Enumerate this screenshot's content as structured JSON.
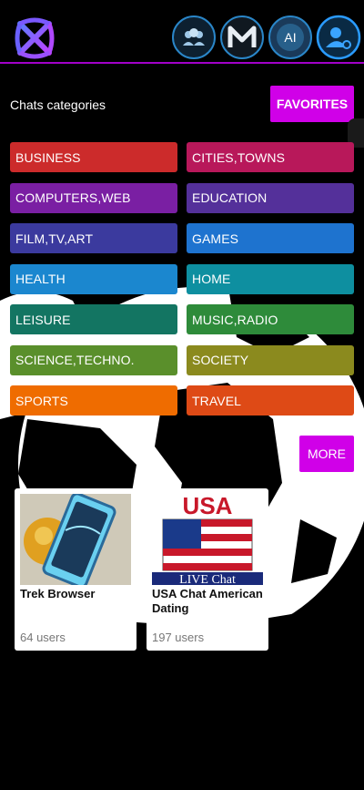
{
  "header": {
    "icons": [
      "app-logo",
      "group-chat-icon",
      "mail-icon",
      "ai-icon",
      "user-settings-icon"
    ],
    "ai_label": "AI"
  },
  "categories_title": "Chats categories",
  "favorites_label": "FAVORITES",
  "categories": [
    {
      "label": "BUSINESS",
      "color": "#cc2b2b"
    },
    {
      "label": "CITIES,TOWNS",
      "color": "#b8185a"
    },
    {
      "label": "COMPUTERS,WEB",
      "color": "#7a1fa3"
    },
    {
      "label": "EDUCATION",
      "color": "#54309a"
    },
    {
      "label": "FILM,TV,ART",
      "color": "#3b3a9e"
    },
    {
      "label": "GAMES",
      "color": "#1e73cf"
    },
    {
      "label": "HEALTH",
      "color": "#1b87cf"
    },
    {
      "label": "HOME",
      "color": "#0e8fa0"
    },
    {
      "label": "LEISURE",
      "color": "#137562"
    },
    {
      "label": "MUSIC,RADIO",
      "color": "#2e8b3a"
    },
    {
      "label": "SCIENCE,TECHNO.",
      "color": "#5a8f2b"
    },
    {
      "label": "SOCIETY",
      "color": "#8b8a1e"
    },
    {
      "label": "SPORTS",
      "color": "#ef6c00"
    },
    {
      "label": "TRAVEL",
      "color": "#de4a16"
    }
  ],
  "more_label": "MORE",
  "cards": [
    {
      "title": "Trek Browser",
      "users": "64 users"
    },
    {
      "title": "USA Chat American Dating",
      "users": "197 users",
      "thumb_text_top": "USA",
      "thumb_text_bottom": "LIVE Chat"
    }
  ]
}
